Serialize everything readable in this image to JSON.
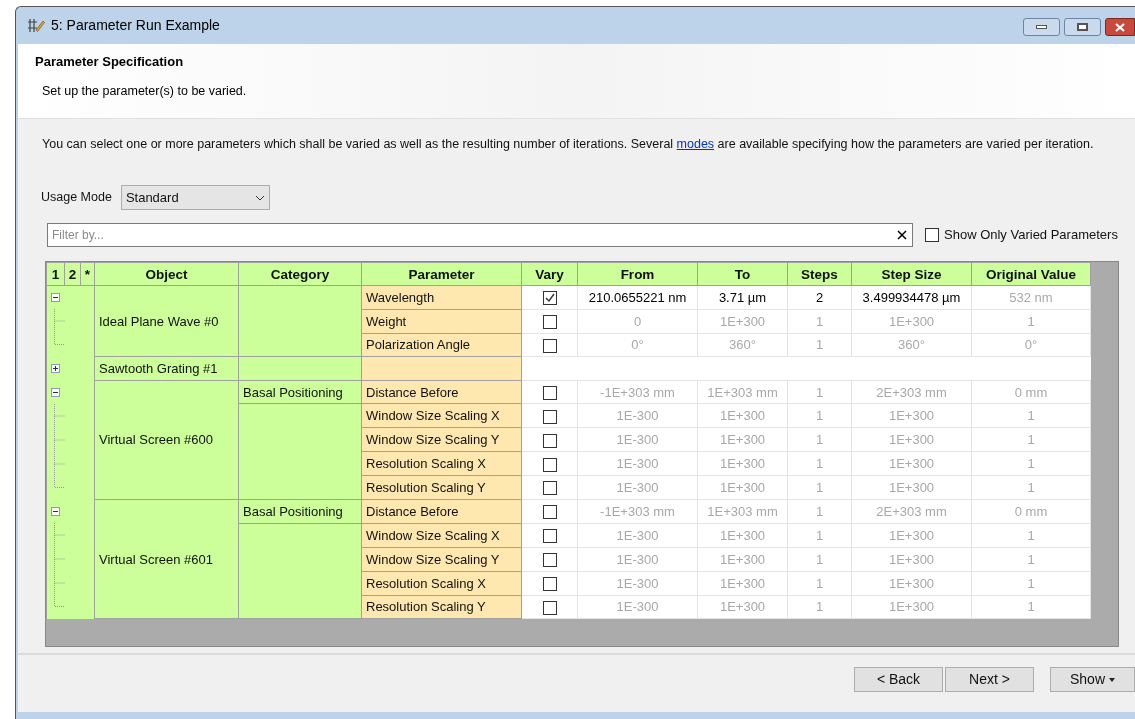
{
  "window": {
    "title": "5: Parameter Run Example"
  },
  "header": {
    "title": "Parameter Specification",
    "subtitle": "Set up the parameter(s) to be varied."
  },
  "intro": {
    "before": "You can select one or more parameters which shall be varied as well as the resulting number of iterations. Several ",
    "link": "modes",
    "after": " are available specifying how the parameters are varied per iteration."
  },
  "usage_mode": {
    "label": "Usage Mode",
    "value": "Standard"
  },
  "filter": {
    "placeholder": "Filter by..."
  },
  "show_only_varied": {
    "label": "Show Only Varied Parameters",
    "checked": false
  },
  "table": {
    "columns": [
      "1",
      "2",
      "*",
      "Object",
      "Category",
      "Parameter",
      "Vary",
      "From",
      "To",
      "Steps",
      "Step Size",
      "Original Value"
    ],
    "objects": [
      {
        "name": "Ideal Plane Wave #0",
        "expanded": true,
        "groups": [
          {
            "params": [
              {
                "name": "Wavelength",
                "vary": true,
                "from": "210.0655221 nm",
                "to": "3.71 µm",
                "steps": "2",
                "step_size": "3.499934478 µm",
                "original": "532 nm"
              },
              {
                "name": "Weight",
                "vary": false,
                "from": "0",
                "to": "1E+300",
                "steps": "1",
                "step_size": "1E+300",
                "original": "1"
              },
              {
                "name": "Polarization Angle",
                "vary": false,
                "from": "0°",
                "to": "360°",
                "steps": "1",
                "step_size": "360°",
                "original": "0°"
              }
            ]
          }
        ]
      },
      {
        "name": "Sawtooth Grating #1",
        "expanded": false
      },
      {
        "name": "Virtual Screen #600",
        "expanded": true,
        "groups": [
          {
            "category": "Basal Positioning",
            "params": [
              {
                "name": "Distance Before",
                "vary": false,
                "from": "-1E+303 mm",
                "to": "1E+303 mm",
                "steps": "1",
                "step_size": "2E+303 mm",
                "original": "0 mm"
              }
            ]
          },
          {
            "params": [
              {
                "name": "Window Size Scaling X",
                "vary": false,
                "from": "1E-300",
                "to": "1E+300",
                "steps": "1",
                "step_size": "1E+300",
                "original": "1"
              },
              {
                "name": "Window Size Scaling Y",
                "vary": false,
                "from": "1E-300",
                "to": "1E+300",
                "steps": "1",
                "step_size": "1E+300",
                "original": "1"
              },
              {
                "name": "Resolution Scaling X",
                "vary": false,
                "from": "1E-300",
                "to": "1E+300",
                "steps": "1",
                "step_size": "1E+300",
                "original": "1"
              },
              {
                "name": "Resolution Scaling Y",
                "vary": false,
                "from": "1E-300",
                "to": "1E+300",
                "steps": "1",
                "step_size": "1E+300",
                "original": "1"
              }
            ]
          }
        ]
      },
      {
        "name": "Virtual Screen #601",
        "expanded": true,
        "groups": [
          {
            "category": "Basal Positioning",
            "params": [
              {
                "name": "Distance Before",
                "vary": false,
                "from": "-1E+303 mm",
                "to": "1E+303 mm",
                "steps": "1",
                "step_size": "2E+303 mm",
                "original": "0 mm"
              }
            ]
          },
          {
            "params": [
              {
                "name": "Window Size Scaling X",
                "vary": false,
                "from": "1E-300",
                "to": "1E+300",
                "steps": "1",
                "step_size": "1E+300",
                "original": "1"
              },
              {
                "name": "Window Size Scaling Y",
                "vary": false,
                "from": "1E-300",
                "to": "1E+300",
                "steps": "1",
                "step_size": "1E+300",
                "original": "1"
              },
              {
                "name": "Resolution Scaling X",
                "vary": false,
                "from": "1E-300",
                "to": "1E+300",
                "steps": "1",
                "step_size": "1E+300",
                "original": "1"
              },
              {
                "name": "Resolution Scaling Y",
                "vary": false,
                "from": "1E-300",
                "to": "1E+300",
                "steps": "1",
                "step_size": "1E+300",
                "original": "1"
              }
            ]
          }
        ]
      }
    ]
  },
  "buttons": [
    {
      "label": "< Back",
      "kind": "plain"
    },
    {
      "label": "Next >",
      "kind": "plain"
    },
    {
      "label": "Show",
      "kind": "dropdown"
    }
  ]
}
